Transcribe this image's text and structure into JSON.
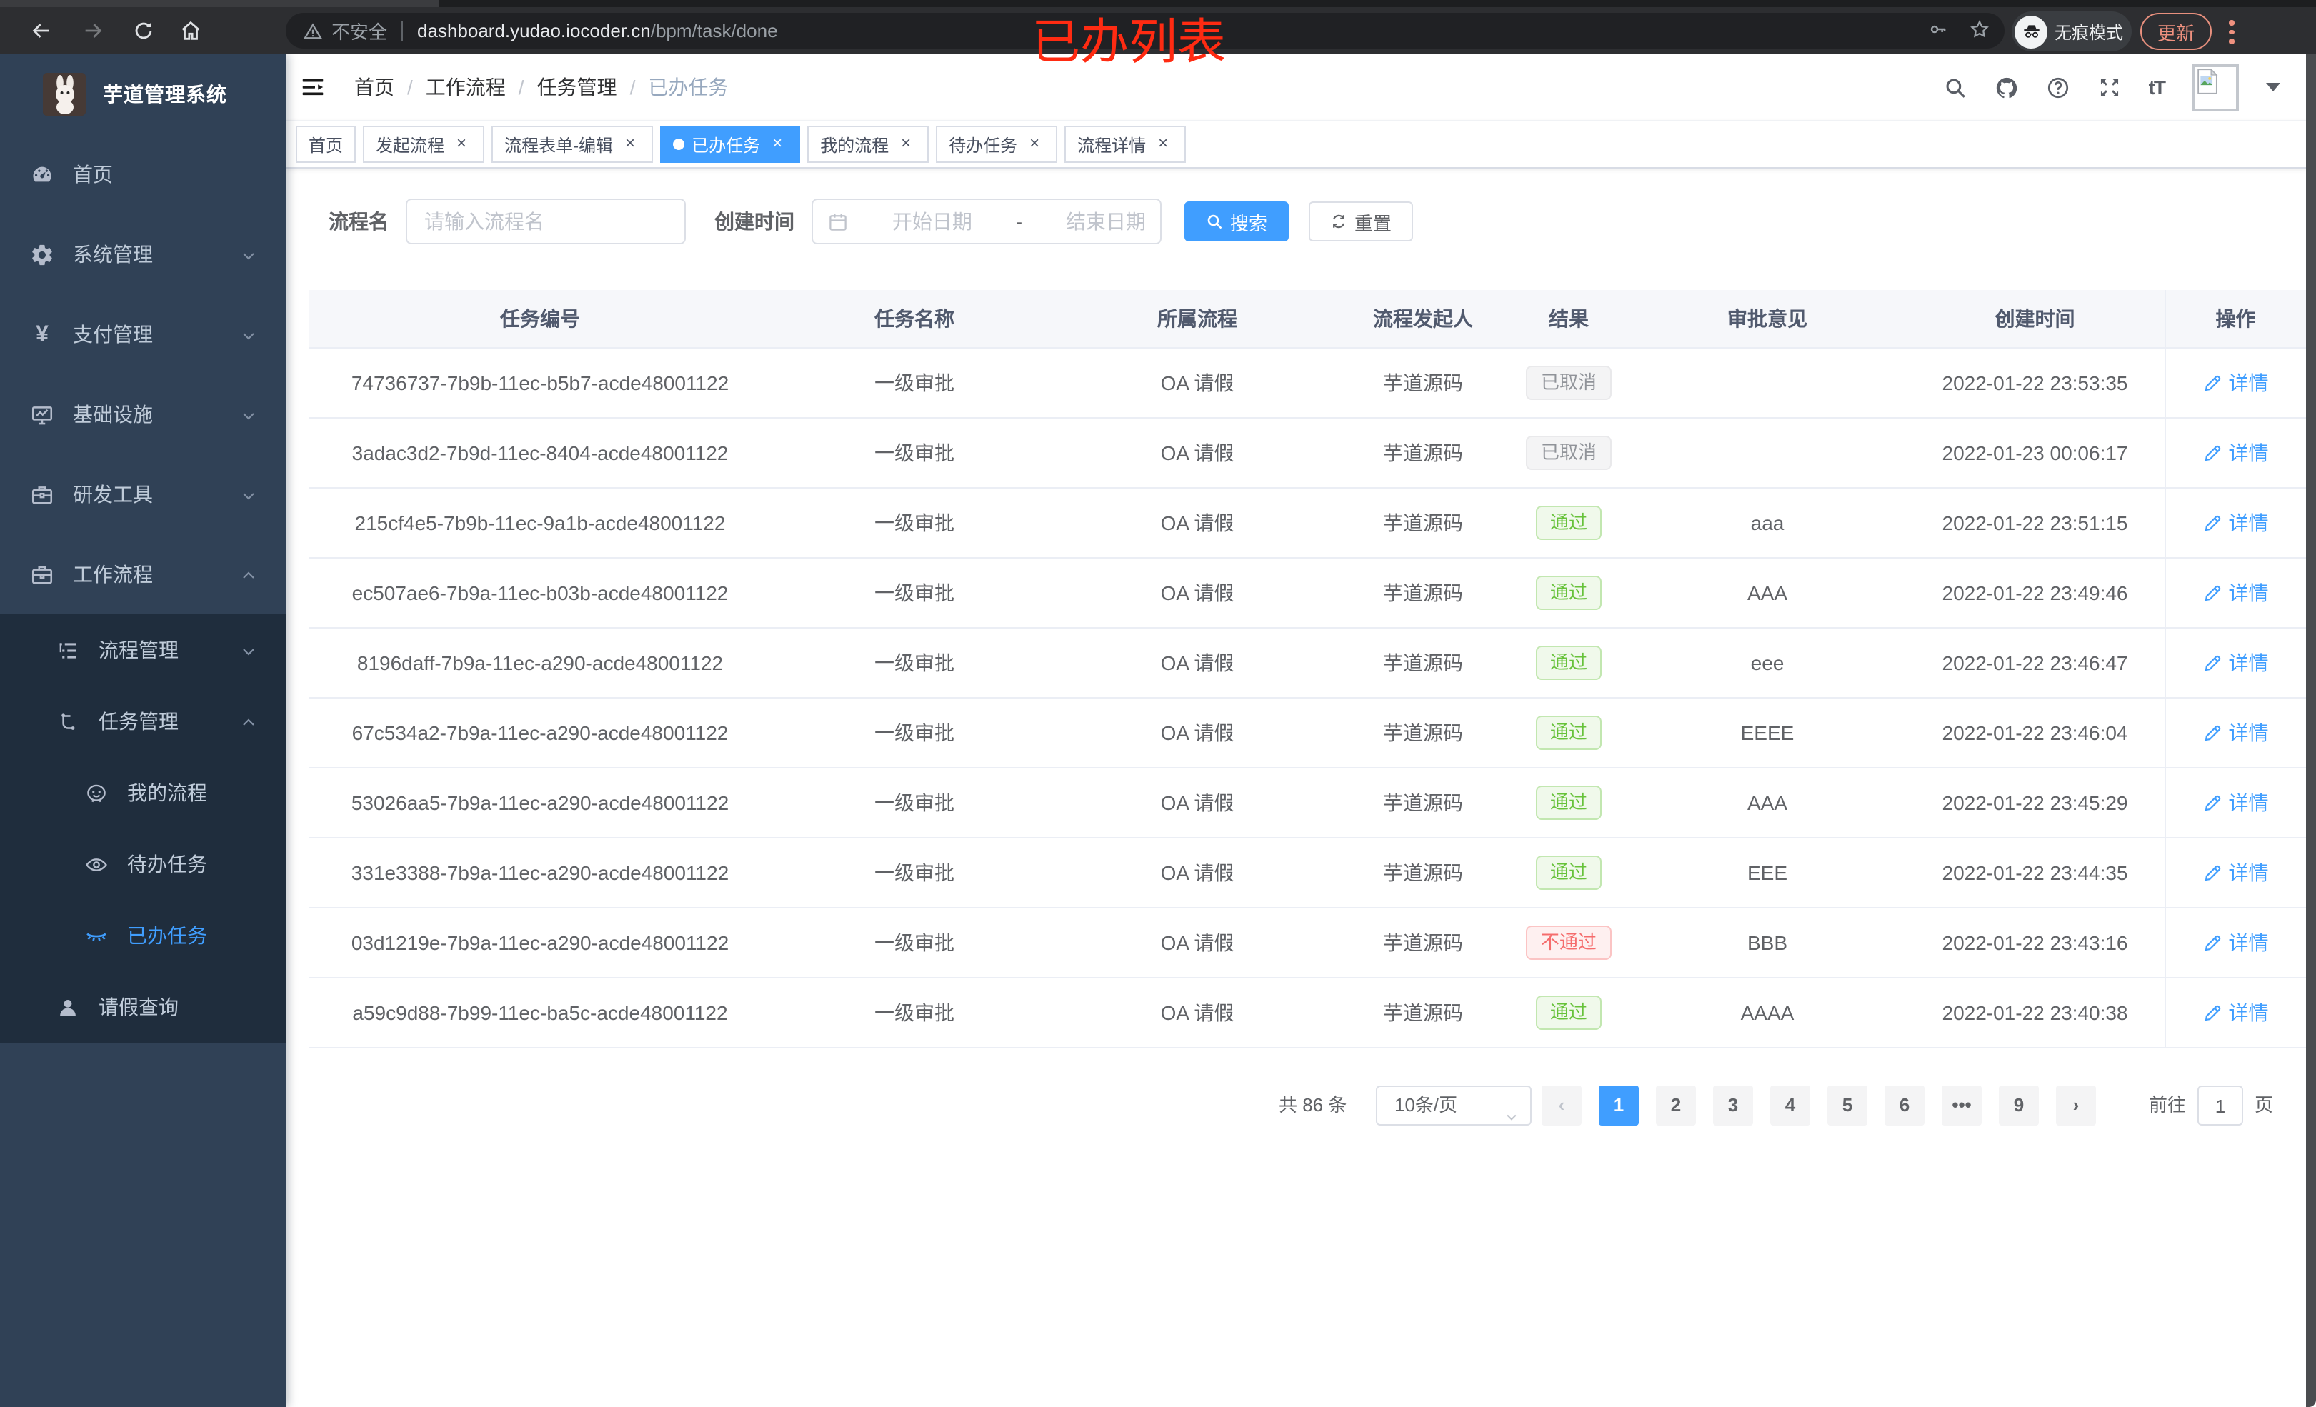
{
  "annotation": "已办列表",
  "browser": {
    "security_label": "不安全",
    "url_domain": "dashboard.yudao.iocoder.cn",
    "url_path": "/bpm/task/done",
    "incognito_label": "无痕模式",
    "update_label": "更新"
  },
  "sidebar": {
    "title": "芋道管理系统",
    "items": [
      {
        "name": "home",
        "label": "首页",
        "icon": "dashboard-icon",
        "level": 1
      },
      {
        "name": "system",
        "label": "系统管理",
        "icon": "gear-icon",
        "level": 1,
        "chevron": "down"
      },
      {
        "name": "payment",
        "label": "支付管理",
        "icon": "yen-icon",
        "glyph": "¥",
        "level": 1,
        "chevron": "down"
      },
      {
        "name": "infrastructure",
        "label": "基础设施",
        "icon": "monitor-icon",
        "level": 1,
        "chevron": "down"
      },
      {
        "name": "dev-tools",
        "label": "研发工具",
        "icon": "toolbox-icon",
        "level": 1,
        "chevron": "down"
      },
      {
        "name": "workflow",
        "label": "工作流程",
        "icon": "briefcase-icon",
        "level": 1,
        "chevron": "up"
      },
      {
        "name": "process-mgmt",
        "label": "流程管理",
        "icon": "tree-icon",
        "level": 2,
        "chevron": "down",
        "dark": true
      },
      {
        "name": "task-mgmt",
        "label": "任务管理",
        "icon": "flow-icon",
        "level": 2,
        "chevron": "up",
        "dark": true
      },
      {
        "name": "my-process",
        "label": "我的流程",
        "icon": "face-icon",
        "level": 3,
        "dark": true
      },
      {
        "name": "todo-tasks",
        "label": "待办任务",
        "icon": "eye-open-icon",
        "level": 3,
        "dark": true
      },
      {
        "name": "done-tasks",
        "label": "已办任务",
        "icon": "eye-closed-icon",
        "level": 3,
        "dark": true,
        "active": true
      },
      {
        "name": "leave-query",
        "label": "请假查询",
        "icon": "user-icon",
        "level": 2,
        "dark": true
      }
    ]
  },
  "navbar": {
    "breadcrumb": [
      "首页",
      "工作流程",
      "任务管理",
      "已办任务"
    ]
  },
  "tabs": [
    {
      "name": "home",
      "label": "首页",
      "closable": false,
      "active": false
    },
    {
      "name": "start-process",
      "label": "发起流程",
      "closable": true,
      "active": false
    },
    {
      "name": "form-edit",
      "label": "流程表单-编辑",
      "closable": true,
      "active": false
    },
    {
      "name": "done-tasks",
      "label": "已办任务",
      "closable": true,
      "active": true
    },
    {
      "name": "my-process",
      "label": "我的流程",
      "closable": true,
      "active": false
    },
    {
      "name": "todo-tasks",
      "label": "待办任务",
      "closable": true,
      "active": false
    },
    {
      "name": "process-detail",
      "label": "流程详情",
      "closable": true,
      "active": false
    }
  ],
  "filters": {
    "name_label": "流程名",
    "name_placeholder": "请输入流程名",
    "date_label": "创建时间",
    "date_start_placeholder": "开始日期",
    "date_separator": "-",
    "date_end_placeholder": "结束日期",
    "search_label": "搜索",
    "reset_label": "重置"
  },
  "table": {
    "columns": [
      {
        "key": "id",
        "label": "任务编号"
      },
      {
        "key": "name",
        "label": "任务名称"
      },
      {
        "key": "flow",
        "label": "所属流程"
      },
      {
        "key": "starter",
        "label": "流程发起人"
      },
      {
        "key": "result",
        "label": "结果"
      },
      {
        "key": "comment",
        "label": "审批意见"
      },
      {
        "key": "time",
        "label": "创建时间"
      },
      {
        "key": "ops",
        "label": "操作"
      }
    ],
    "detail_label": "详情",
    "rows": [
      {
        "id": "74736737-7b9b-11ec-b5b7-acde48001122",
        "name": "一级审批",
        "flow": "OA 请假",
        "starter": "芋道源码",
        "result": "已取消",
        "result_type": "info",
        "comment": "",
        "time": "2022-01-22 23:53:35"
      },
      {
        "id": "3adac3d2-7b9d-11ec-8404-acde48001122",
        "name": "一级审批",
        "flow": "OA 请假",
        "starter": "芋道源码",
        "result": "已取消",
        "result_type": "info",
        "comment": "",
        "time": "2022-01-23 00:06:17"
      },
      {
        "id": "215cf4e5-7b9b-11ec-9a1b-acde48001122",
        "name": "一级审批",
        "flow": "OA 请假",
        "starter": "芋道源码",
        "result": "通过",
        "result_type": "success",
        "comment": "aaa",
        "time": "2022-01-22 23:51:15"
      },
      {
        "id": "ec507ae6-7b9a-11ec-b03b-acde48001122",
        "name": "一级审批",
        "flow": "OA 请假",
        "starter": "芋道源码",
        "result": "通过",
        "result_type": "success",
        "comment": "AAA",
        "time": "2022-01-22 23:49:46"
      },
      {
        "id": "8196daff-7b9a-11ec-a290-acde48001122",
        "name": "一级审批",
        "flow": "OA 请假",
        "starter": "芋道源码",
        "result": "通过",
        "result_type": "success",
        "comment": "eee",
        "time": "2022-01-22 23:46:47"
      },
      {
        "id": "67c534a2-7b9a-11ec-a290-acde48001122",
        "name": "一级审批",
        "flow": "OA 请假",
        "starter": "芋道源码",
        "result": "通过",
        "result_type": "success",
        "comment": "EEEE",
        "time": "2022-01-22 23:46:04"
      },
      {
        "id": "53026aa5-7b9a-11ec-a290-acde48001122",
        "name": "一级审批",
        "flow": "OA 请假",
        "starter": "芋道源码",
        "result": "通过",
        "result_type": "success",
        "comment": "AAA",
        "time": "2022-01-22 23:45:29"
      },
      {
        "id": "331e3388-7b9a-11ec-a290-acde48001122",
        "name": "一级审批",
        "flow": "OA 请假",
        "starter": "芋道源码",
        "result": "通过",
        "result_type": "success",
        "comment": "EEE",
        "time": "2022-01-22 23:44:35"
      },
      {
        "id": "03d1219e-7b9a-11ec-a290-acde48001122",
        "name": "一级审批",
        "flow": "OA 请假",
        "starter": "芋道源码",
        "result": "不通过",
        "result_type": "danger",
        "comment": "BBB",
        "time": "2022-01-22 23:43:16"
      },
      {
        "id": "a59c9d88-7b99-11ec-ba5c-acde48001122",
        "name": "一级审批",
        "flow": "OA 请假",
        "starter": "芋道源码",
        "result": "通过",
        "result_type": "success",
        "comment": "AAAA",
        "time": "2022-01-22 23:40:38"
      }
    ]
  },
  "pagination": {
    "total_label": "共 86 条",
    "page_size": "10条/页",
    "pages": [
      "1",
      "2",
      "3",
      "4",
      "5",
      "6",
      "•••",
      "9"
    ],
    "active_page": "1",
    "goto_label": "前往",
    "goto_value": "1",
    "page_label": "页"
  },
  "glyphs": {
    "close": "×",
    "separator": "/",
    "prev": "‹",
    "next": "›",
    "font_size": "tT"
  },
  "colors": {
    "accent": "#409eff",
    "success": "#67c23a",
    "danger": "#f56c6c",
    "info": "#909399",
    "sidebar": "#304156",
    "sidebar_dark": "#1f2d3d"
  }
}
